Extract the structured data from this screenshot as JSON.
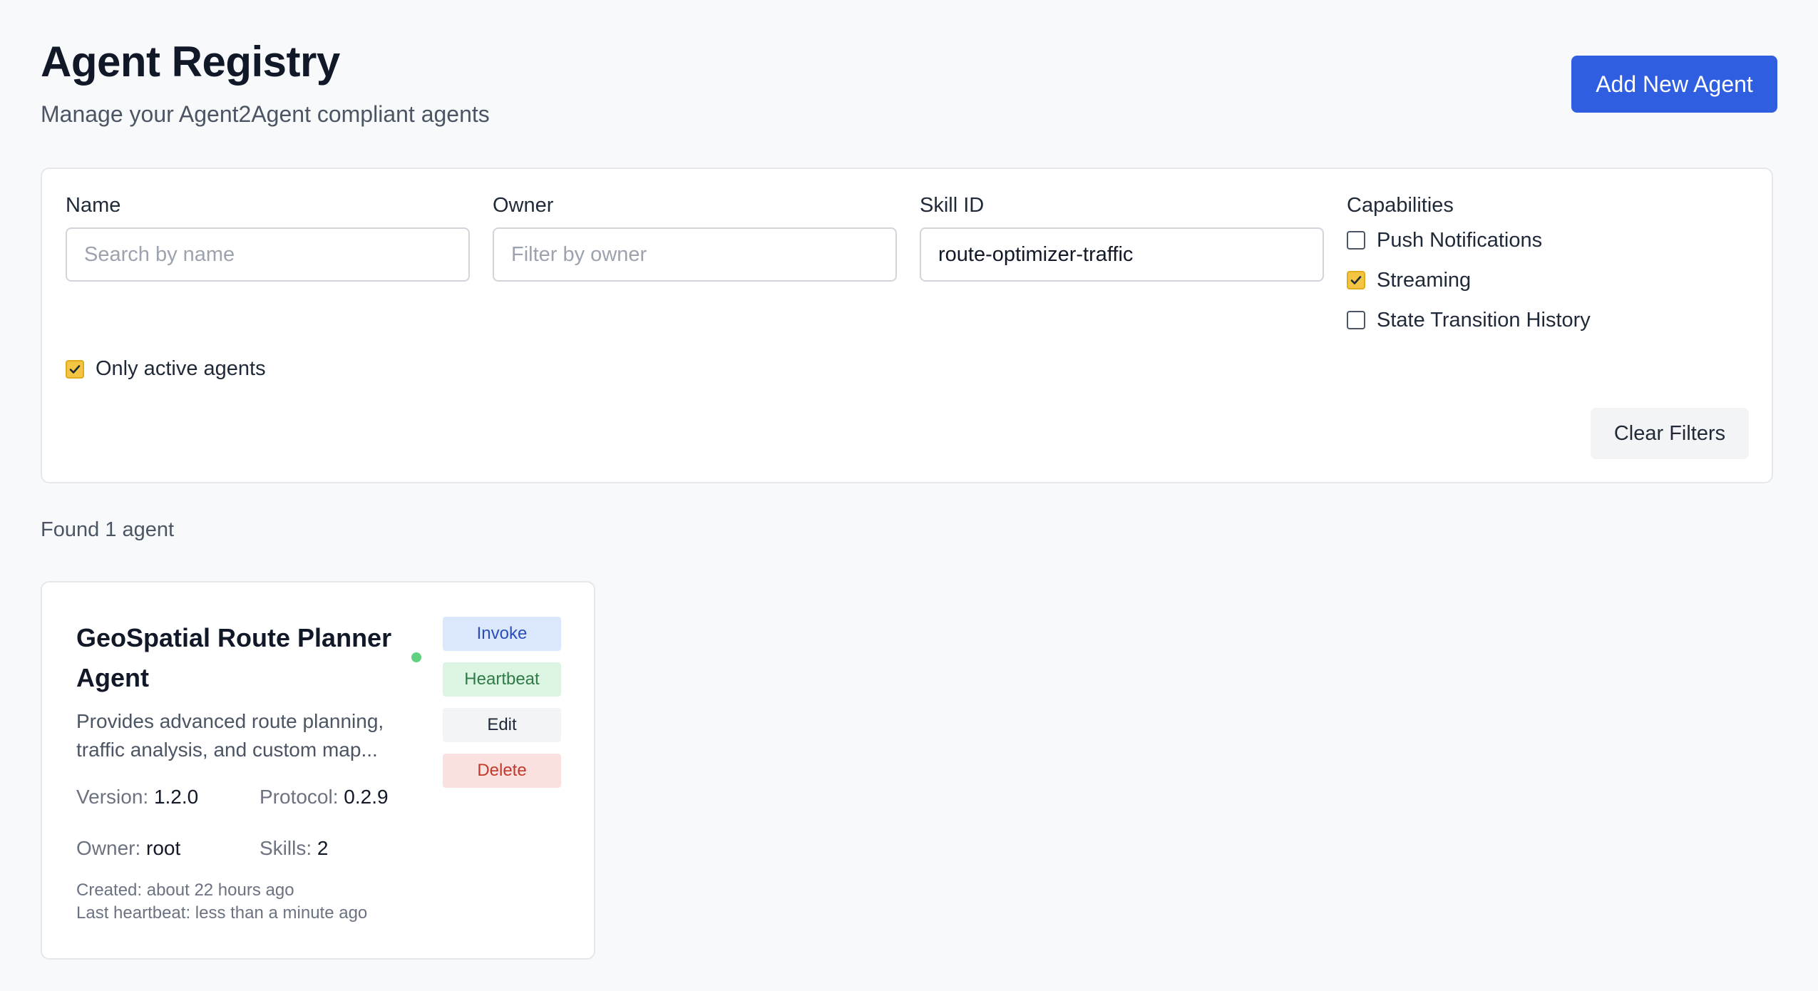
{
  "header": {
    "title": "Agent Registry",
    "subtitle": "Manage your Agent2Agent compliant agents",
    "add_button": "Add New Agent"
  },
  "filters": {
    "name": {
      "label": "Name",
      "placeholder": "Search by name",
      "value": ""
    },
    "owner": {
      "label": "Owner",
      "placeholder": "Filter by owner",
      "value": ""
    },
    "skill_id": {
      "label": "Skill ID",
      "placeholder": "",
      "value": "route-optimizer-traffic"
    },
    "capabilities": {
      "label": "Capabilities",
      "options": [
        {
          "label": "Push Notifications",
          "checked": false
        },
        {
          "label": "Streaming",
          "checked": true
        },
        {
          "label": "State Transition History",
          "checked": false
        }
      ]
    },
    "only_active": {
      "label": "Only active agents",
      "checked": true
    },
    "clear_button": "Clear Filters"
  },
  "results": {
    "found_text": "Found 1 agent",
    "agents": [
      {
        "name": "GeoSpatial Route Planner Agent",
        "status": "active",
        "status_color": "#5fd17f",
        "description": "Provides advanced route planning, traffic analysis, and custom map...",
        "version_label": "Version:",
        "version": "1.2.0",
        "protocol_label": "Protocol:",
        "protocol": "0.2.9",
        "owner_label": "Owner:",
        "owner": "root",
        "skills_label": "Skills:",
        "skills": "2",
        "created": "Created: about 22 hours ago",
        "last_heartbeat": "Last heartbeat: less than a minute ago",
        "actions": {
          "invoke": "Invoke",
          "heartbeat": "Heartbeat",
          "edit": "Edit",
          "delete": "Delete"
        }
      }
    ]
  },
  "colors": {
    "primary": "#2f5ee0",
    "checkbox_checked": "#f4c542",
    "background": "#f8f9fb"
  }
}
